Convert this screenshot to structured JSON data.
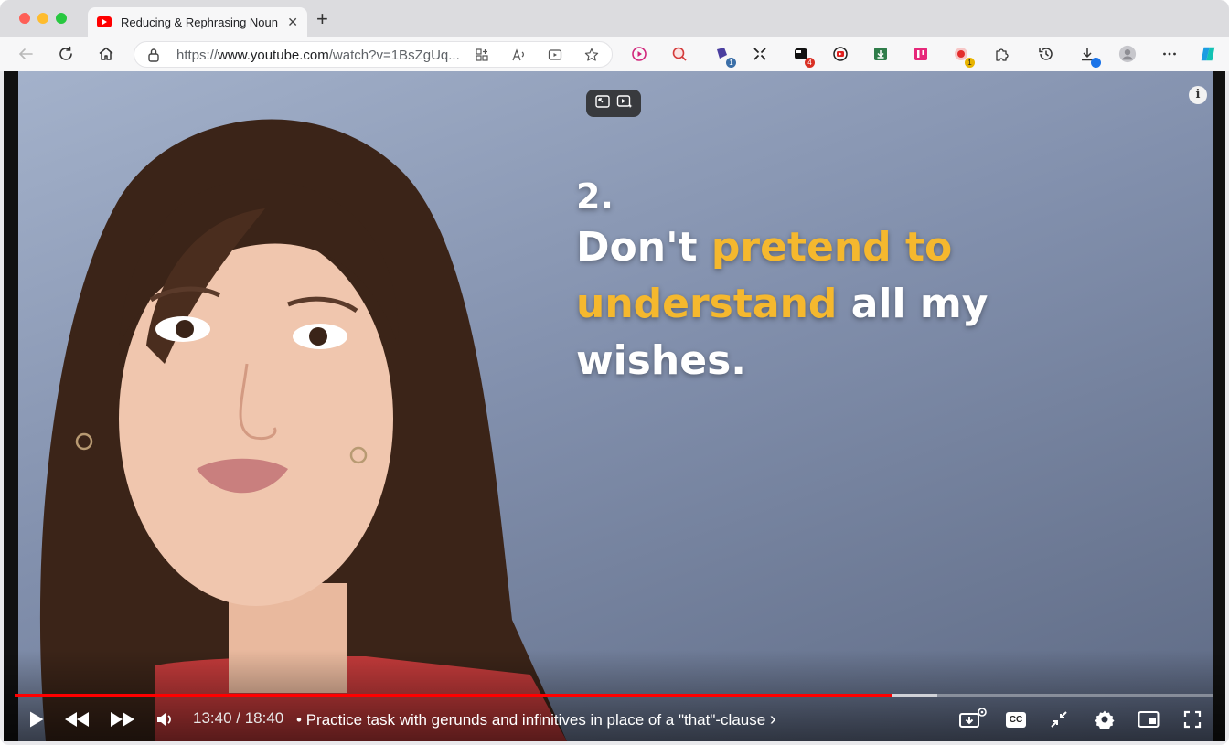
{
  "browser": {
    "tab_title": "Reducing & Rephrasing Noun Clauses",
    "tab_close": "✕",
    "new_tab": "+",
    "url_prefix": "https://",
    "url_host": "www.youtube.com",
    "url_path": "/watch?v=1BsZgUq...",
    "extension_badges": [
      "1",
      "4",
      "1"
    ]
  },
  "video": {
    "lesson_number": "2.",
    "line1_plain": "Don't ",
    "line1_highlight": "pretend to",
    "line2_highlight": "understand",
    "line2_plain": " all my",
    "line3_plain": "wishes.",
    "highlight_color": "#f5b82e",
    "info_label": "i"
  },
  "player": {
    "current_time": "13:40",
    "duration": "18:40",
    "time_separator": " / ",
    "chapter_bullet": "•",
    "chapter_title": "Practice task with gerunds and infinitives in place of a \"that\"-clause",
    "chapter_chevron": "›",
    "played_fraction": 0.732,
    "buffered_fraction": 0.77,
    "cc_label": "CC",
    "accent_color": "#ff0000"
  }
}
